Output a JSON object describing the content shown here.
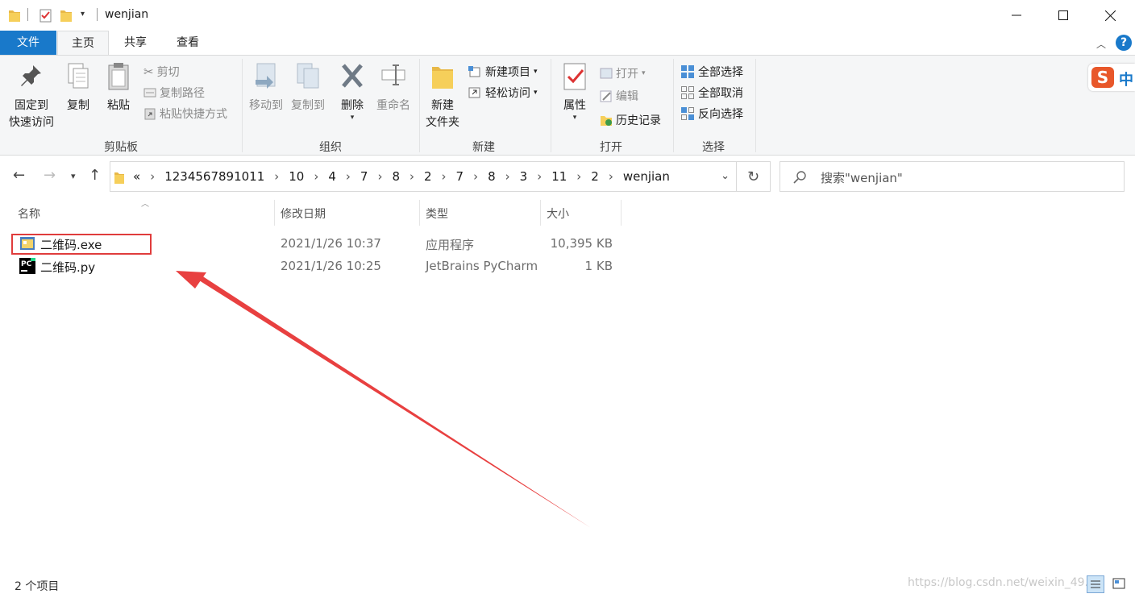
{
  "window": {
    "title": "wenjian"
  },
  "tabs": [
    {
      "label": "文件"
    },
    {
      "label": "主页"
    },
    {
      "label": "共享"
    },
    {
      "label": "查看"
    }
  ],
  "ribbon": {
    "clipboard": {
      "pin_line1": "固定到",
      "pin_line2": "快速访问",
      "copy": "复制",
      "paste": "粘贴",
      "cut": "剪切",
      "copy_path": "复制路径",
      "paste_shortcut": "粘贴快捷方式",
      "group": "剪贴板"
    },
    "organize": {
      "move_to": "移动到",
      "copy_to": "复制到",
      "delete": "删除",
      "rename": "重命名",
      "group": "组织"
    },
    "new": {
      "new_folder_line1": "新建",
      "new_folder_line2": "文件夹",
      "new_item": "新建项目",
      "easy_access": "轻松访问",
      "group": "新建"
    },
    "open": {
      "properties": "属性",
      "open": "打开",
      "edit": "编辑",
      "history": "历史记录",
      "group": "打开"
    },
    "select": {
      "select_all": "全部选择",
      "select_none": "全部取消",
      "invert": "反向选择",
      "group": "选择"
    }
  },
  "address": {
    "overflow": "«",
    "crumbs": [
      "1234567891011",
      "10",
      "4",
      "7",
      "8",
      "2",
      "7",
      "8",
      "3",
      "11",
      "2",
      "wenjian"
    ],
    "search_placeholder": "搜索\"wenjian\""
  },
  "columns": {
    "name": "名称",
    "modified": "修改日期",
    "type": "类型",
    "size": "大小"
  },
  "files": [
    {
      "name": "二维码.exe",
      "modified": "2021/1/26 10:37",
      "type": "应用程序",
      "size": "10,395 KB",
      "icon": "exe-icon"
    },
    {
      "name": "二维码.py",
      "modified": "2021/1/26 10:25",
      "type": "JetBrains PyCharm",
      "size": "1 KB",
      "icon": "pycharm-icon"
    }
  ],
  "status": {
    "count": "2 个项目"
  },
  "watermark": "https://blog.csdn.net/weixin_49...",
  "ime": {
    "label": "中"
  },
  "colors": {
    "accent": "#1979ca",
    "highlight_box": "#e03c3c",
    "arrow": "#e84040"
  }
}
